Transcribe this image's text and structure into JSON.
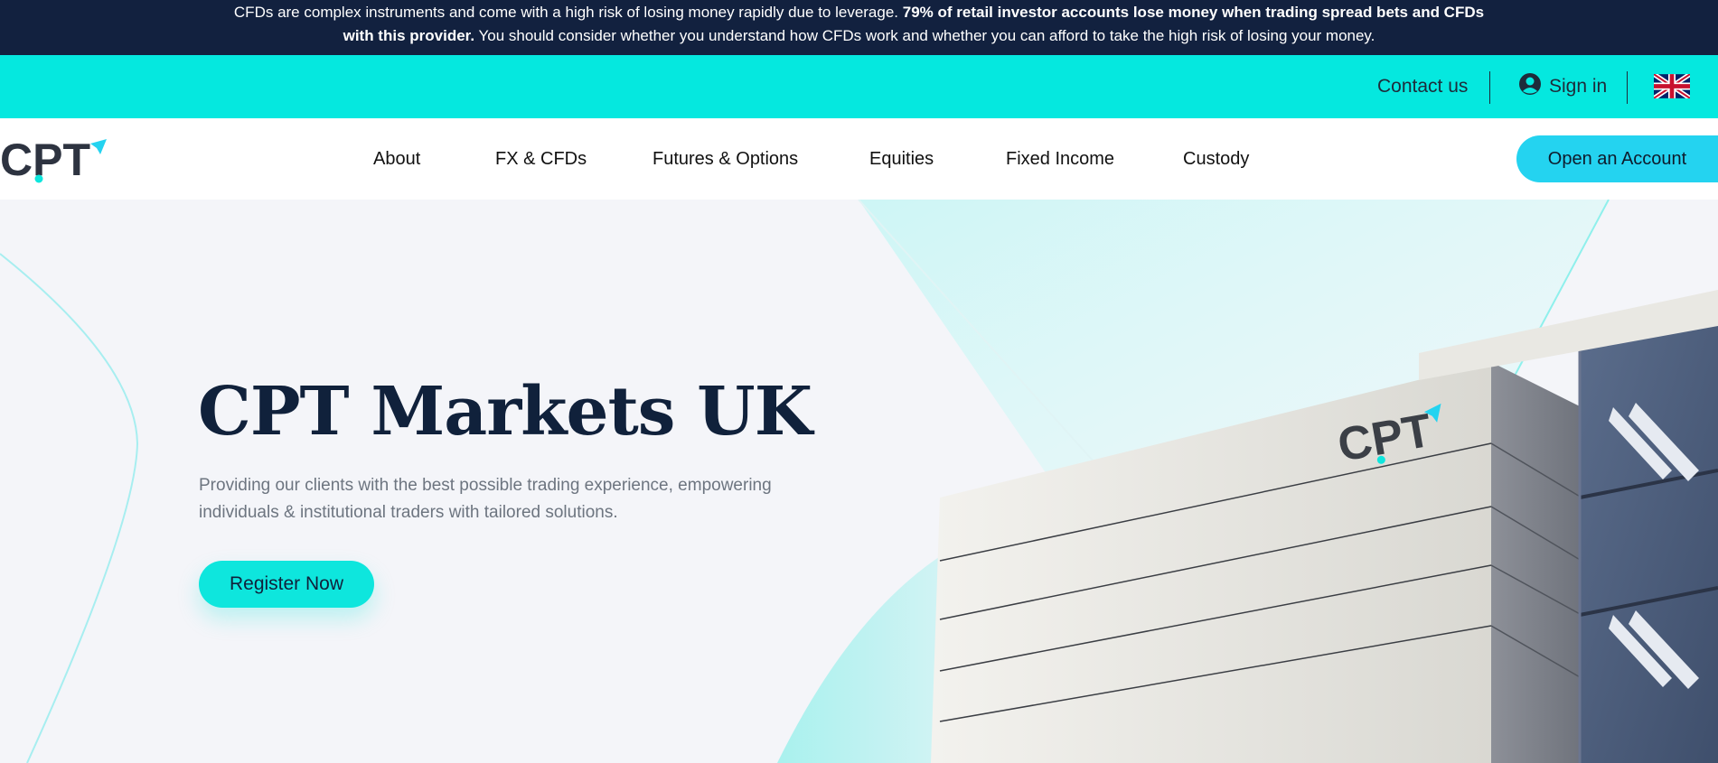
{
  "risk_warning": {
    "text_before": "CFDs are complex instruments and come with a high risk of losing money rapidly due to leverage. ",
    "bold": "79% of retail investor accounts lose money when trading spread bets and CFDs with this provider.",
    "text_after": " You should consider whether you understand how CFDs work and whether you can afford to take the high risk of losing your money."
  },
  "utility": {
    "contact_label": "Contact us",
    "signin_label": "Sign in",
    "language_icon": "uk-flag-icon",
    "user_icon": "user-circle-icon"
  },
  "nav": {
    "logo_text": "CPT",
    "items": [
      "About",
      "FX & CFDs",
      "Futures & Options",
      "Equities",
      "Fixed Income",
      "Custody"
    ],
    "cta_label": "Open an Account"
  },
  "hero": {
    "title": "CPT Markets UK",
    "subtitle": "Providing our clients with the best possible trading experience, empowering individuals & institutional traders with tailored solutions.",
    "register_label": "Register Now",
    "building_logo_text": "CPT"
  },
  "colors": {
    "banner_bg": "#12213f",
    "accent_cyan": "#05e8df",
    "cta_blue": "#24d3f0",
    "title_navy": "#10213b"
  }
}
